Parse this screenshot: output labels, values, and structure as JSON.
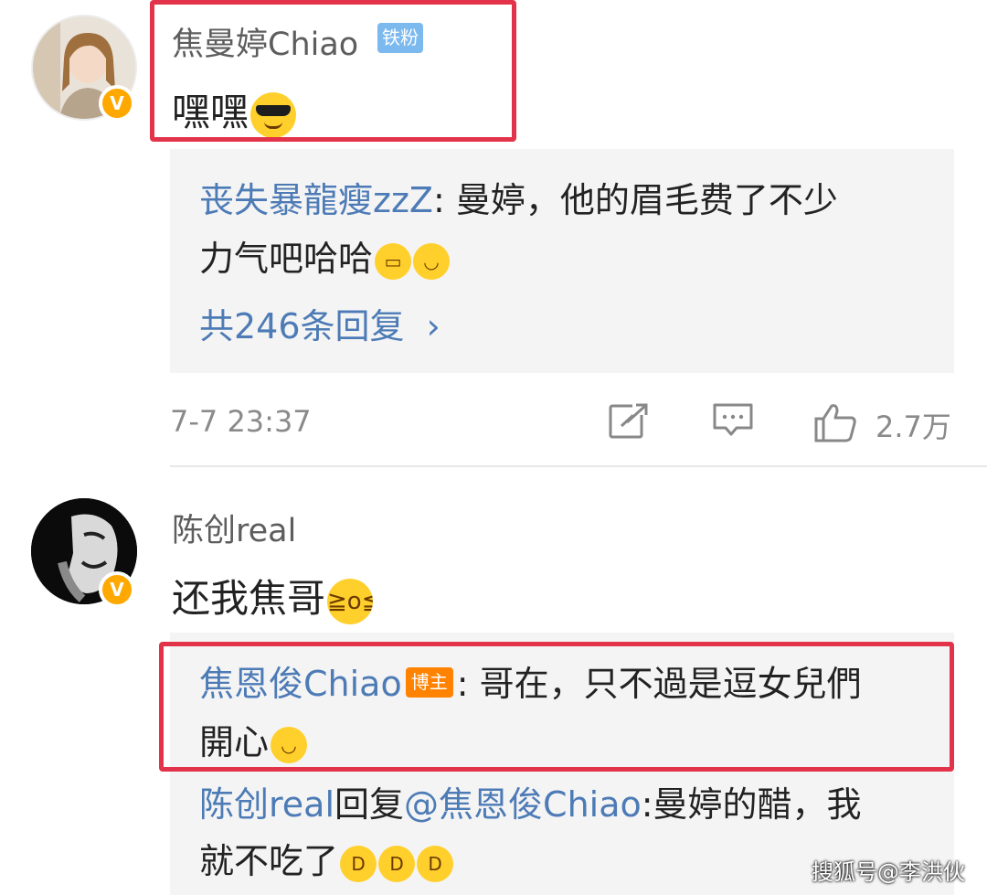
{
  "comments": [
    {
      "username": "焦曼婷Chiao",
      "badge": "铁粉",
      "verified_mark": "V",
      "content": "嘿嘿",
      "content_emoji": "cool-sunglasses-emoji",
      "reply_preview": {
        "author": "丧失暴龍瘦zzZ",
        "text_line1": ": 曼婷，他的眉毛费了不少",
        "text_line2": "力气吧哈哈",
        "emojis": [
          "grin-emoji",
          "laugh-tears-emoji"
        ],
        "more_label": "共246条回复",
        "more_chevron": "›"
      },
      "timestamp": "7-7 23:37",
      "like_count": "2.7万",
      "actions": [
        "repost-icon",
        "comment-icon",
        "like-icon"
      ]
    },
    {
      "username": "陈创real",
      "verified_mark": "V",
      "content": "还我焦哥",
      "content_emoji": "crying-emoji",
      "replies": [
        {
          "author": "焦恩俊Chiao",
          "badge": "博主",
          "text_line1": ": 哥在，只不過是逗女兒們",
          "text_line2": "開心",
          "emojis": [
            "smile-emoji"
          ]
        },
        {
          "author": "陈创real",
          "reply_word": "回复",
          "mention": "@焦恩俊Chiao",
          "text_line1": ":曼婷的醋，我",
          "text_line2": "就不吃了",
          "emojis": [
            "big-grin-emoji",
            "big-grin-emoji",
            "big-grin-emoji"
          ]
        }
      ]
    }
  ],
  "watermark": "搜狐号@李洪伙",
  "colors": {
    "link_blue": "#4d7bb6",
    "highlight_red": "#e2334a",
    "verified_orange": "#ffa800",
    "fan_badge_blue": "#7cb9ee",
    "boss_badge_orange": "#ff8200",
    "reply_bg": "#f4f4f4"
  }
}
